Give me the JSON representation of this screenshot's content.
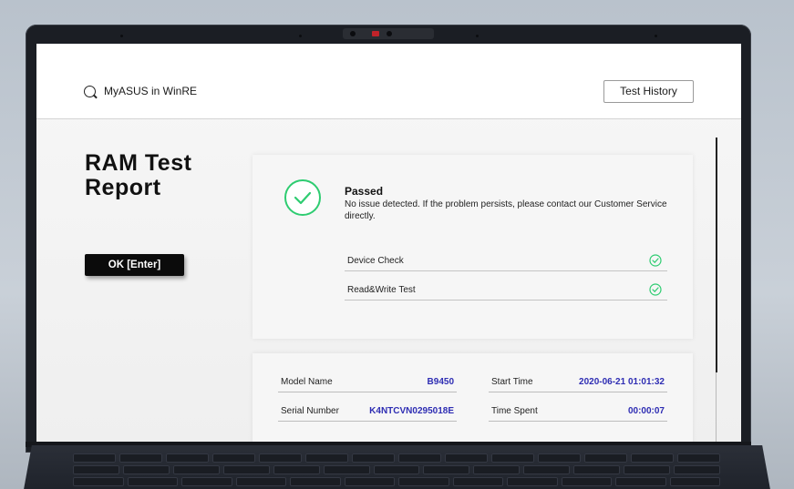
{
  "app": {
    "title": "MyASUS in WinRE",
    "icon": "search-icon"
  },
  "header": {
    "history_label": "Test History"
  },
  "page": {
    "title": "RAM Test Report",
    "ok_label": "OK [Enter]"
  },
  "result": {
    "status": "Passed",
    "description": "No issue detected. If the problem persists, please contact our Customer Service directly.",
    "icon": "check-circle-icon",
    "accent": "#2ecc71",
    "checks": [
      {
        "label": "Device Check",
        "icon": "check-circle-icon"
      },
      {
        "label": "Read&Write Test",
        "icon": "check-circle-icon"
      }
    ]
  },
  "info": {
    "model_name_label": "Model Name",
    "model_name_value": "B9450",
    "serial_label": "Serial Number",
    "serial_value": "K4NTCVN0295018E",
    "start_time_label": "Start Time",
    "start_time_value": "2020-06-21 01:01:32",
    "time_spent_label": "Time Spent",
    "time_spent_value": "00:00:07",
    "value_color": "#2e2db3"
  }
}
